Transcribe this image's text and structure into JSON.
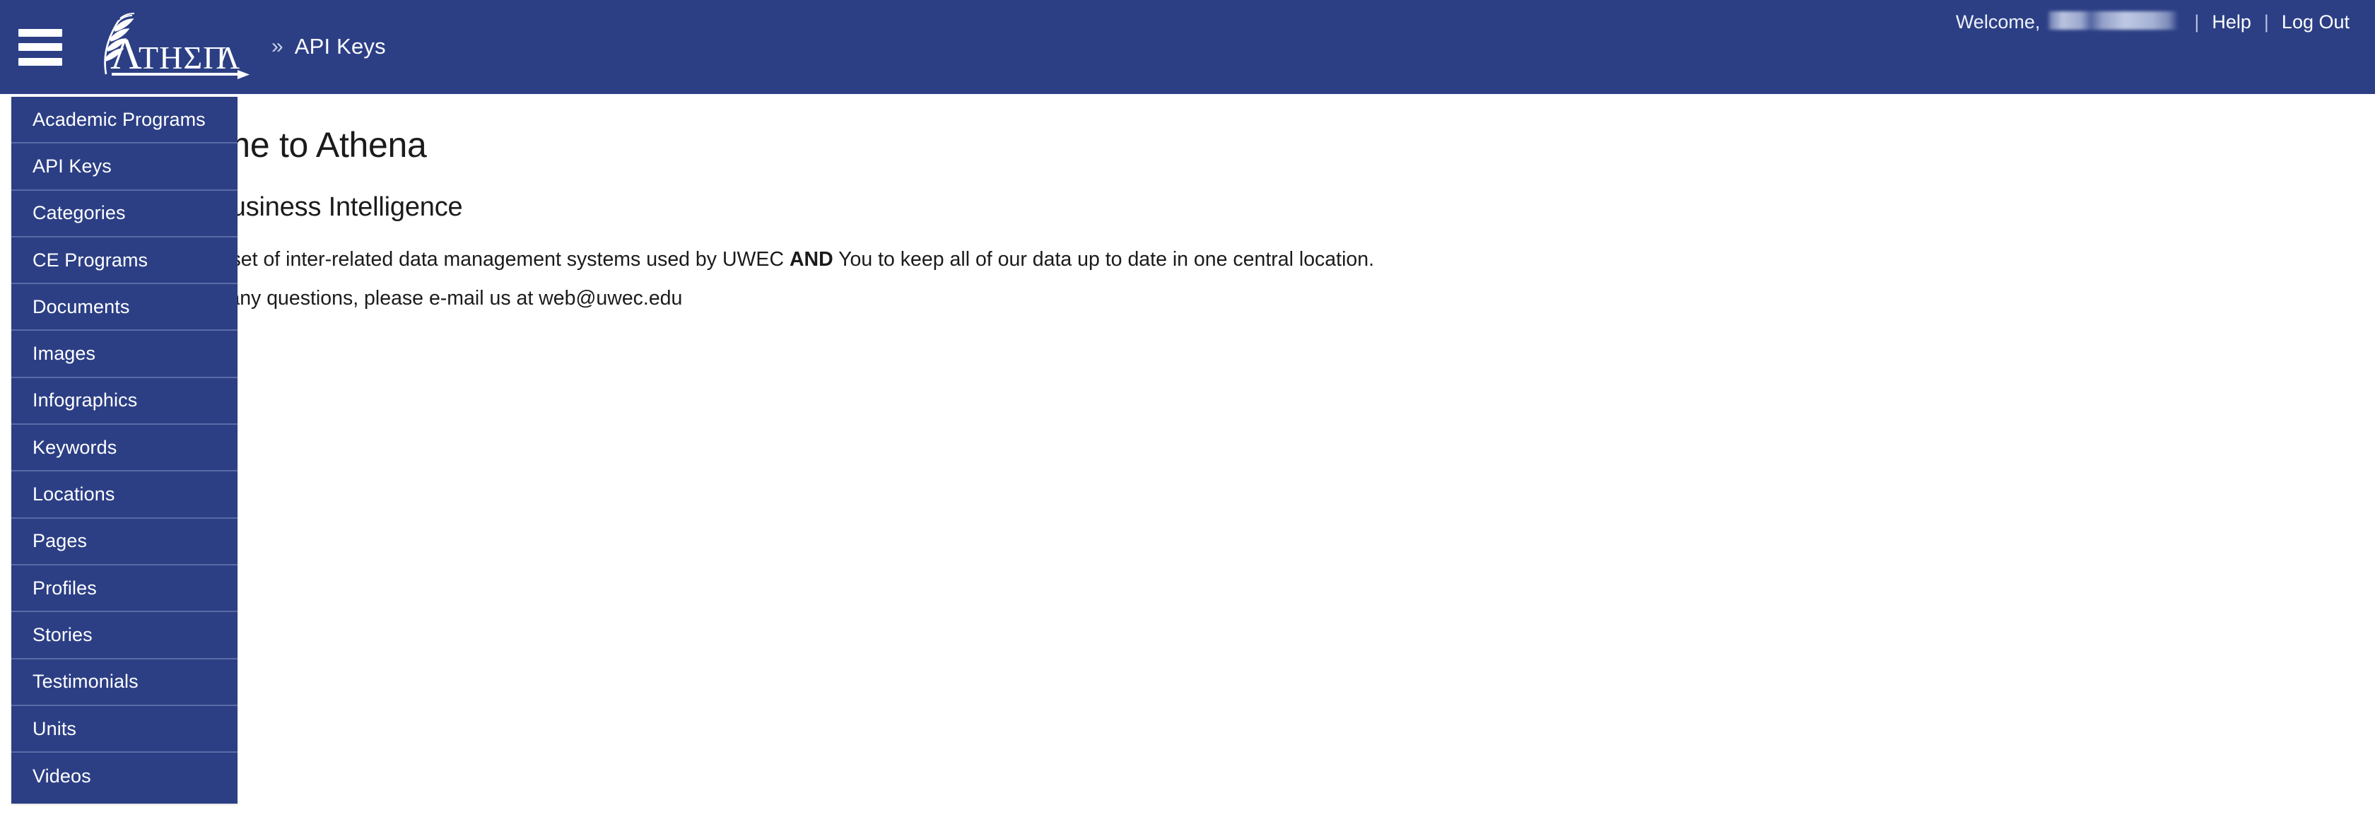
{
  "header": {
    "menu_icon": "hamburger-menu-icon",
    "logo_text": "ΑΤΗΕΝΑ",
    "logo_alt": "Athena logo with olive branch and arrow underline",
    "breadcrumb_separator": "»",
    "breadcrumb_current": "API Keys",
    "welcome_label": "Welcome,",
    "username_redacted": "",
    "divider": "|",
    "help_label": "Help",
    "logout_label": "Log Out",
    "background_color": "#2C3F85",
    "text_color": "#FFFFFF"
  },
  "sidebar": {
    "background_color": "#2C3F85",
    "separator_color": "#5A6AA5",
    "items": [
      {
        "label": "Academic Programs"
      },
      {
        "label": "API Keys"
      },
      {
        "label": "Categories"
      },
      {
        "label": "CE Programs"
      },
      {
        "label": "Documents"
      },
      {
        "label": "Images"
      },
      {
        "label": "Infographics"
      },
      {
        "label": "Keywords"
      },
      {
        "label": "Locations"
      },
      {
        "label": "Pages"
      },
      {
        "label": "Profiles"
      },
      {
        "label": "Stories"
      },
      {
        "label": "Testimonials"
      },
      {
        "label": "Units"
      },
      {
        "label": "Videos"
      }
    ]
  },
  "main": {
    "title": "Welcome to Athena",
    "subtitle": "UWEC Business Intelligence",
    "paragraph_1_prefix": "Athena is a set of inter-related data management systems used by UWEC ",
    "paragraph_1_bold": "AND",
    "paragraph_1_suffix": " You to keep all of our data up to date in one central location.",
    "paragraph_2": "If you have any questions, please e-mail us at web@uwec.edu",
    "text_color": "#1B1B1B",
    "background_color": "#FFFFFF"
  }
}
